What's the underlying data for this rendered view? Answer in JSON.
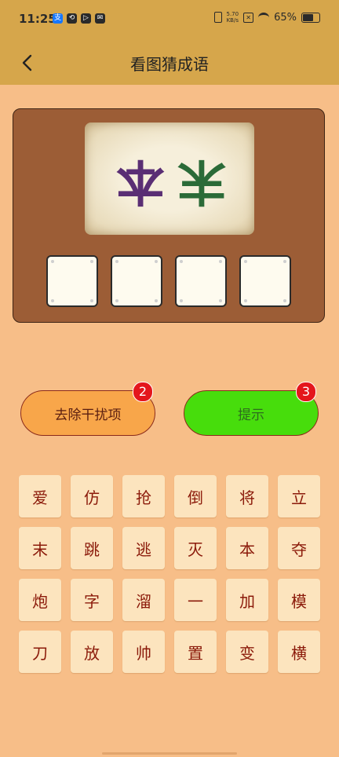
{
  "status_bar": {
    "time": "11:25",
    "net_speed_top": "5.70",
    "net_speed_bottom": "KB/s",
    "battery": "65%"
  },
  "header": {
    "title": "看图猜成语"
  },
  "puzzle": {
    "glyph_left": "本",
    "glyph_right": "末"
  },
  "answer_slots": [
    "",
    "",
    "",
    ""
  ],
  "actions": {
    "remove_label": "去除干扰项",
    "remove_count": "2",
    "hint_label": "提示",
    "hint_count": "3"
  },
  "characters": [
    [
      "爱",
      "仿",
      "抢",
      "倒",
      "将",
      "立"
    ],
    [
      "末",
      "跳",
      "逃",
      "灭",
      "本",
      "夺"
    ],
    [
      "炮",
      "字",
      "溜",
      "一",
      "加",
      "模"
    ],
    [
      "刀",
      "放",
      "帅",
      "置",
      "变",
      "横"
    ]
  ]
}
